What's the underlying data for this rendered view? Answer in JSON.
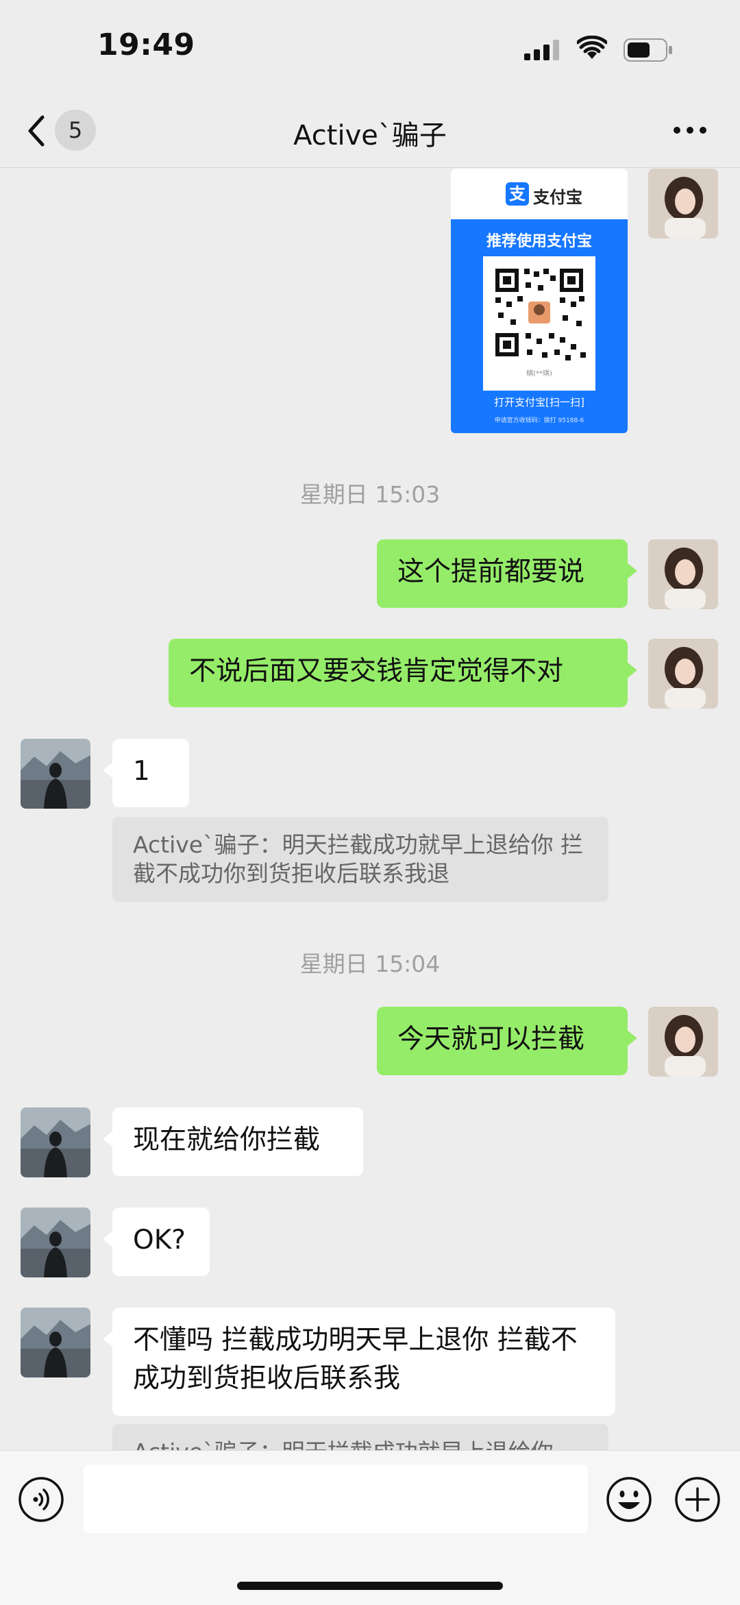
{
  "status": {
    "time": "19:49"
  },
  "header": {
    "back_count": "5",
    "title": "Active`骗子"
  },
  "alipay_card": {
    "brand": "支付宝",
    "headline": "推荐使用支付宝",
    "name": "棋(**琪)",
    "scan": "打开支付宝[扫一扫]",
    "footer": "申请官方收钱码：拨打 95188-6"
  },
  "messages": {
    "ts1": "星期日 15:03",
    "m1": "这个提前都要说",
    "m2": "不说后面又要交钱肯定觉得不对",
    "m3": "1",
    "q1": "Active`骗子：明天拦截成功就早上退给你 拦截不成功你到货拒收后联系我退",
    "ts2": "星期日 15:04",
    "m4": "今天就可以拦截",
    "m5": "现在就给你拦截",
    "m6": "OK?",
    "m7": "不懂吗 拦截成功明天早上退你 拦截不成功到货拒收后联系我",
    "q2": "Active`骗子：明天拦截成功就早上退给你"
  },
  "icons": {
    "back": "chevron-left-icon",
    "more": "more-icon",
    "voice": "voice-icon",
    "emoji": "emoji-icon",
    "plus": "plus-icon"
  }
}
